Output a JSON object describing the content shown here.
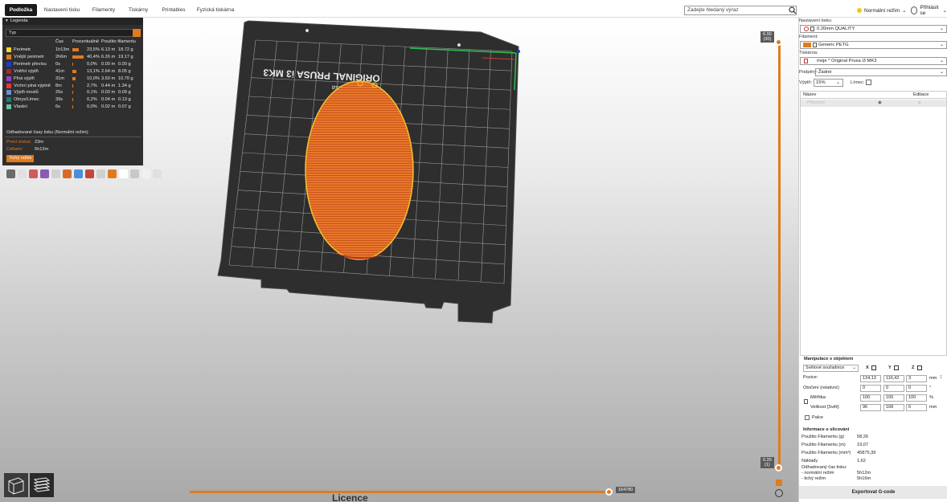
{
  "topbar": {
    "tabs": [
      "Podložka",
      "Nastavení tisku",
      "Filamenty",
      "Tiskárny",
      "Printables",
      "Fyzická tiskárna"
    ],
    "search_placeholder": "Zadejte hledaný výraz",
    "mode_label": "Normální režim",
    "login_label": "Přihlásit se"
  },
  "bed": {
    "text_line1": "ORIGINAL PRUSA i3 MK3",
    "text_line2": "by Josef Prusa"
  },
  "legend": {
    "title": "Legenda",
    "type_select": "Typ",
    "columns": [
      "Čas",
      "Procentuálně",
      "Použito filamentu"
    ],
    "rows": [
      {
        "name": "Perimetr",
        "time": "1h13m",
        "pct": "23,5%",
        "pct_val": 23.5,
        "len": "6.13 m",
        "weight": "18.72 g",
        "color": "#f6d32d"
      },
      {
        "name": "Vnější perimetr",
        "time": "2h6m",
        "pct": "40,4%",
        "pct_val": 40.4,
        "len": "6.26 m",
        "weight": "19.17 g",
        "color": "#e07b1f"
      },
      {
        "name": "Perimetr převisu",
        "time": "0s",
        "pct": "0,0%",
        "pct_val": 0,
        "len": "0.00 m",
        "weight": "0.00 g",
        "color": "#1d3bd1"
      },
      {
        "name": "Vnitřní výplň",
        "time": "41m",
        "pct": "13,1%",
        "pct_val": 13.1,
        "len": "2.64 m",
        "weight": "8.05 g",
        "color": "#a8282e"
      },
      {
        "name": "Plná výplň",
        "time": "31m",
        "pct": "10,0%",
        "pct_val": 10.0,
        "len": "3.50 m",
        "weight": "10.70 g",
        "color": "#9c3fc4"
      },
      {
        "name": "Vrchní plná výplně",
        "time": "8m",
        "pct": "2,7%",
        "pct_val": 2.7,
        "len": "0.44 m",
        "weight": "1.34 g",
        "color": "#e03a3a"
      },
      {
        "name": "Výplň mostů",
        "time": "25s",
        "pct": "0,1%",
        "pct_val": 0.1,
        "len": "0.03 m",
        "weight": "0.09 g",
        "color": "#6f8fcf"
      },
      {
        "name": "Obrys/Límec",
        "time": "39s",
        "pct": "0,2%",
        "pct_val": 0.2,
        "len": "0.04 m",
        "weight": "0.13 g",
        "color": "#1d7a7a"
      },
      {
        "name": "Vlastní",
        "time": "6s",
        "pct": "0,0%",
        "pct_val": 0.0,
        "len": "0.02 m",
        "weight": "0.07 g",
        "color": "#5ec9a0"
      }
    ],
    "estimate_title": "Odhadované časy tisku (Normální režim):",
    "first_layer_label": "První vrstva:",
    "first_layer_value": "23m",
    "total_label": "Celkem:",
    "total_value": "5h12m",
    "quiet_mode_button": "Tichý režim"
  },
  "sliders": {
    "top_value": "6.00",
    "top_layer": "(30)",
    "bottom_value": "0.20",
    "bottom_layer": "(1)",
    "horizontal_value": "164780"
  },
  "bottom_text": "Licence",
  "right_panel": {
    "print_settings_label": "Nastavení tisku:",
    "print_settings_value": "0.20mm QUALITY",
    "filament_label": "Filament:",
    "filament_value": "Generic PETG",
    "filament_color": "#e07b1f",
    "printer_label": "Tiskárna:",
    "printer_value": "moje * Original Prusa i3 MK3",
    "supports_label": "Podpěry:",
    "supports_value": "Žádné",
    "infill_label": "Výplň:",
    "infill_value": "15%",
    "brim_label": "Límec:",
    "list_col_name": "Název",
    "list_col_edit": "Editace",
    "object_name": "Přítomný"
  },
  "manipulation": {
    "title": "Manipulace s objektem",
    "coord_system": "Světové souřadnice",
    "axes": [
      "X",
      "Y",
      "Z"
    ],
    "position_label": "Pozice:",
    "position": [
      "134,13",
      "116,42",
      "3"
    ],
    "position_unit": "mm",
    "rotation_label": "Otočení (relativní):",
    "rotation": [
      "0",
      "0",
      "0"
    ],
    "rotation_unit": "°",
    "scale_label": "Měřítka:",
    "scale": [
      "100",
      "100",
      "100"
    ],
    "scale_unit": "%",
    "size_label": "Velikost [Svět]:",
    "size": [
      "96",
      "168",
      "6"
    ],
    "size_unit": "mm",
    "inches_label": "Palce"
  },
  "slicing_info": {
    "title": "Informace o slicování",
    "rows": [
      {
        "label": "Použito Filamentu (g)",
        "value": "58,26"
      },
      {
        "label": "Použito Filamentu (m)",
        "value": "19,07"
      },
      {
        "label": "Použito Filamentu (mm³)",
        "value": "45875,39"
      },
      {
        "label": "Náklady",
        "value": "1,62"
      }
    ],
    "time_title": "Odhadovaný čas tisku:",
    "normal_label": "- normální režim",
    "normal_value": "5h12m",
    "quiet_label": "- tichý režim",
    "quiet_value": "5h16m"
  },
  "export_button": "Exportovat G-code"
}
